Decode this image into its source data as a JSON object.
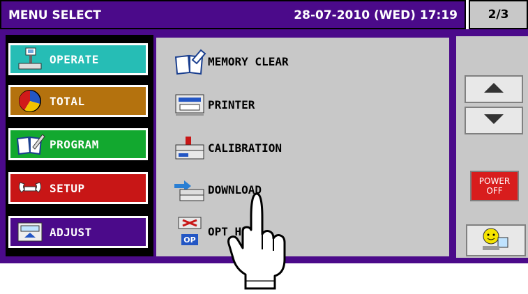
{
  "titlebar": {
    "title": "MENU SELECT",
    "datetime": "28-07-2010 (WED) 17:19",
    "page": "2/3"
  },
  "categories": [
    {
      "label": "OPERATE",
      "icon": "scale-terminal-icon",
      "color": "#26bdb5"
    },
    {
      "label": "TOTAL",
      "icon": "pie-chart-icon",
      "color": "#b4720e"
    },
    {
      "label": "PROGRAM",
      "icon": "book-pen-icon",
      "color": "#12a82f"
    },
    {
      "label": "SETUP",
      "icon": "wrench-icon",
      "color": "#c81616"
    },
    {
      "label": "ADJUST",
      "icon": "scale-display-icon",
      "color": "#4b0a8a"
    }
  ],
  "menu_items": [
    {
      "label": "MEMORY CLEAR",
      "icon": "memory-clear-icon"
    },
    {
      "label": "PRINTER",
      "icon": "printer-icon"
    },
    {
      "label": "CALIBRATION",
      "icon": "calibration-icon"
    },
    {
      "label": "DOWNLOAD",
      "icon": "download-icon"
    },
    {
      "label": "OPT  HECK",
      "icon": "option-check-icon",
      "badge": "OP"
    }
  ],
  "side_buttons": {
    "power_line1": "POWER",
    "power_line2": "OFF"
  }
}
